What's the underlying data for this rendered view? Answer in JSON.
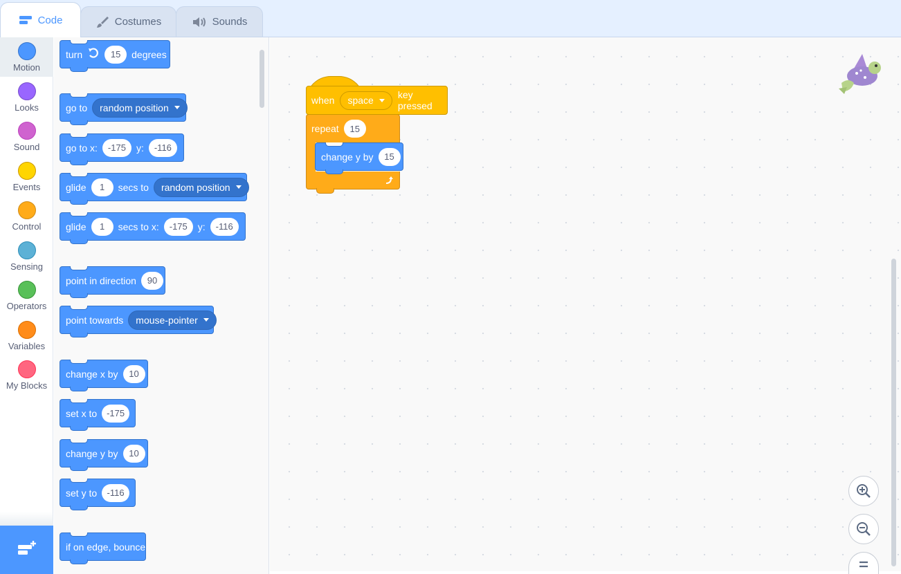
{
  "tabs": [
    {
      "label": "Code",
      "icon": "code-icon",
      "active": true
    },
    {
      "label": "Costumes",
      "icon": "brush-icon",
      "active": false
    },
    {
      "label": "Sounds",
      "icon": "speaker-icon",
      "active": false
    }
  ],
  "categories": [
    {
      "label": "Motion",
      "color": "#4c97ff",
      "selected": true
    },
    {
      "label": "Looks",
      "color": "#9966ff"
    },
    {
      "label": "Sound",
      "color": "#cf63cf"
    },
    {
      "label": "Events",
      "color": "#ffd500"
    },
    {
      "label": "Control",
      "color": "#ffab19"
    },
    {
      "label": "Sensing",
      "color": "#5cb1d6"
    },
    {
      "label": "Operators",
      "color": "#59c059"
    },
    {
      "label": "Variables",
      "color": "#ff8c1a"
    },
    {
      "label": "My Blocks",
      "color": "#ff6680"
    }
  ],
  "palette": {
    "turn": {
      "label": "turn",
      "value": "15",
      "suffix": "degrees"
    },
    "go_to": {
      "label": "go to",
      "option": "random position"
    },
    "go_to_xy": {
      "label": "go to x:",
      "x": "-175",
      "ylabel": "y:",
      "y": "-116"
    },
    "glide_to": {
      "label": "glide",
      "secs": "1",
      "mid": "secs to",
      "option": "random position"
    },
    "glide_xy": {
      "label": "glide",
      "secs": "1",
      "mid": "secs to x:",
      "x": "-175",
      "ylabel": "y:",
      "y": "-116"
    },
    "point_dir": {
      "label": "point in direction",
      "value": "90"
    },
    "point_towards": {
      "label": "point towards",
      "option": "mouse-pointer"
    },
    "change_x": {
      "label": "change x by",
      "value": "10"
    },
    "set_x": {
      "label": "set x to",
      "value": "-175"
    },
    "change_y": {
      "label": "change y by",
      "value": "10"
    },
    "set_y": {
      "label": "set y to",
      "value": "-116"
    },
    "bounce": {
      "label": "if on edge, bounce"
    }
  },
  "script": {
    "hat": {
      "label": "when",
      "key": "space",
      "suffix": "key pressed"
    },
    "repeat": {
      "label": "repeat",
      "value": "15"
    },
    "inner": {
      "label": "change y by",
      "value": "15"
    }
  },
  "zoom": {
    "zoom_in": "zoom-in-icon",
    "zoom_out": "zoom-out-icon",
    "reset": "zoom-reset-icon"
  }
}
